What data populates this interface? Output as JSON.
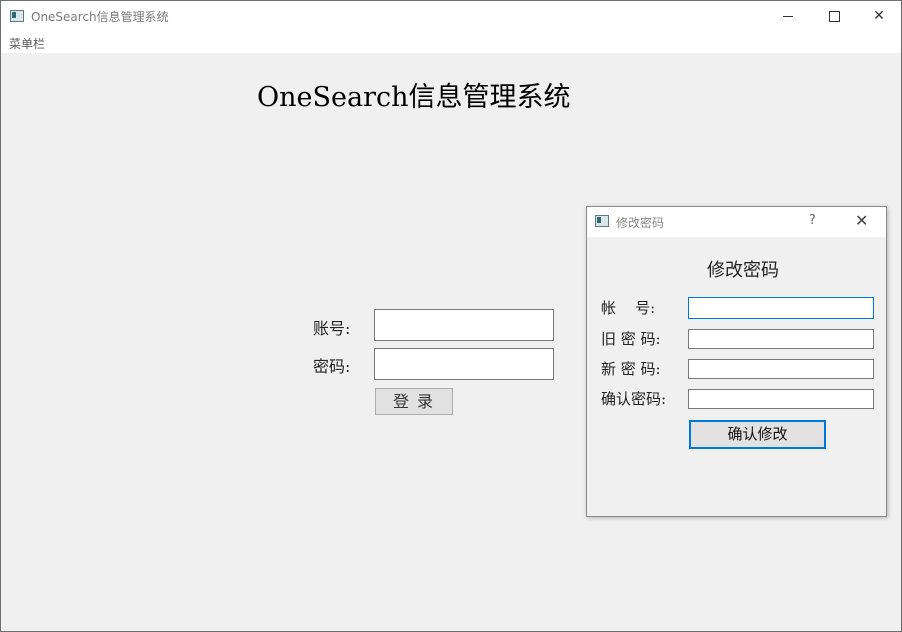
{
  "window": {
    "title": "OneSearch信息管理系统",
    "min_icon": "minimize-icon",
    "max_icon": "maximize-icon",
    "close_glyph": "✕"
  },
  "menubar": {
    "label": "菜单栏"
  },
  "main": {
    "title": "OneSearch信息管理系统",
    "account_label": "账号:",
    "password_label": "密码:",
    "account_value": "",
    "password_value": "",
    "login_button": "登录"
  },
  "dialog": {
    "title": "修改密码",
    "help_glyph": "?",
    "close_glyph": "✕",
    "heading": "修改密码",
    "account_label": "帐    号:",
    "old_password_label": "旧 密 码:",
    "new_password_label": "新 密 码:",
    "confirm_password_label": "确认密码:",
    "account_value": "",
    "old_password_value": "",
    "new_password_value": "",
    "confirm_password_value": "",
    "confirm_button": "确认修改"
  },
  "colors": {
    "focus_accent": "#0078d7",
    "background": "#f0f0f0"
  }
}
